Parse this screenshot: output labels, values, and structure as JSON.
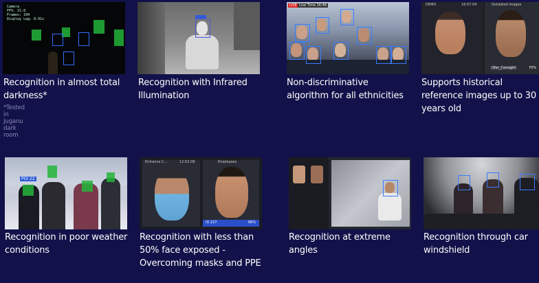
{
  "features": [
    {
      "caption": "Recognition in almost total darkness*",
      "note": "*Tested in Juganu dark room"
    },
    {
      "caption": "Recognition with Infrared Illumination"
    },
    {
      "caption": "Non-discriminative algorithm for all ethnicities"
    },
    {
      "caption": "Supports historical reference images up to 30 years old"
    },
    {
      "caption": "Recognition in poor weather conditions"
    },
    {
      "caption": "Recognition with less than 50% face exposed - Overcoming masks and PPE"
    },
    {
      "caption": "Recognition at extreme angles"
    },
    {
      "caption": "Recognition through car windshield"
    }
  ],
  "thumbs": {
    "dark": {
      "overlay": [
        "Camera",
        "FPS: 15.0",
        "Frames: 194",
        "Display Lag: 0.01s"
      ]
    },
    "ethnic": {
      "live_tag": "LIVE",
      "time_tag": "Live Time 16:46"
    },
    "historic": {
      "left_header": "DEMO",
      "left_time": "16:07:04",
      "right_header": "Outdated images",
      "name_tag": "Ofer_Consight",
      "score_tag": "70%"
    },
    "weather": {
      "tag": "POI 22"
    },
    "mask": {
      "left_header": "Entrance C...",
      "left_time": "12:52:08",
      "right_header": "Employees",
      "id_tag": "ID 227",
      "score_tag": "66%"
    }
  },
  "colors": {
    "background": "#13114a",
    "box": "#3b7bff",
    "detect_green": "#25b53a"
  }
}
